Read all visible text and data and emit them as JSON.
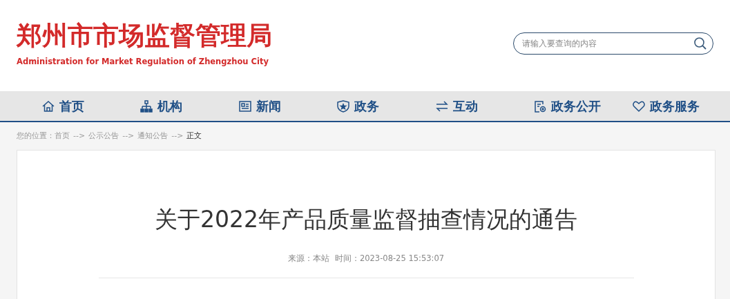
{
  "header": {
    "title": "郑州市市场监督管理局",
    "subtitle": "Administration for Market Regulation of Zhengzhou City"
  },
  "search": {
    "placeholder": "请输入要查询的内容"
  },
  "nav": [
    {
      "label": "首页",
      "kind": "home"
    },
    {
      "label": "机构",
      "kind": "org"
    },
    {
      "label": "新闻",
      "kind": "news"
    },
    {
      "label": "政务",
      "kind": "shield"
    },
    {
      "label": "互动",
      "kind": "swap"
    },
    {
      "label": "政务公开",
      "kind": "doc"
    },
    {
      "label": "政务服务",
      "kind": "heart"
    }
  ],
  "breadcrumb": [
    {
      "text": "您的位置：",
      "kind": "label"
    },
    {
      "text": "首页",
      "kind": "link"
    },
    {
      "text": "-->",
      "kind": "sep"
    },
    {
      "text": "公示公告",
      "kind": "link"
    },
    {
      "text": "-->",
      "kind": "sep"
    },
    {
      "text": "通知公告",
      "kind": "link"
    },
    {
      "text": "-->",
      "kind": "sep"
    },
    {
      "text": "正文",
      "kind": "current"
    }
  ],
  "article": {
    "title": "关于2022年产品质量监督抽查情况的通告",
    "source": "来源：本站",
    "time": "时间：2023-08-25 15:53:07"
  }
}
